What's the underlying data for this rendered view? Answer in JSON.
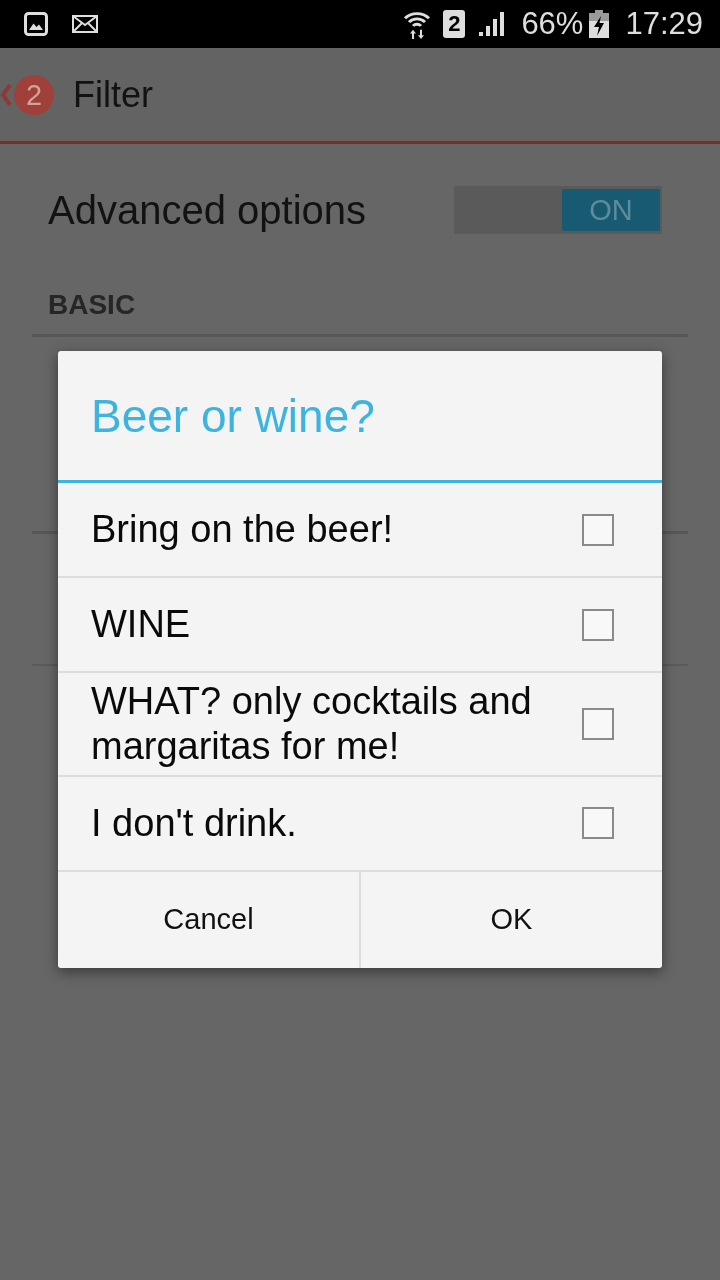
{
  "status_bar": {
    "sim_slot": "2",
    "battery": "66%",
    "time": "17:29"
  },
  "app_bar": {
    "badge": "2",
    "title": "Filter"
  },
  "settings": {
    "advanced": {
      "label": "Advanced options",
      "toggle": {
        "label": "ON",
        "on": true
      }
    },
    "sections": [
      {
        "header": "BASIC"
      }
    ]
  },
  "dialog": {
    "title": "Beer or wine?",
    "options": [
      {
        "label": "Bring on the beer!",
        "checked": false
      },
      {
        "label": "WINE",
        "checked": false
      },
      {
        "label": "WHAT? only cocktails and margaritas for me!",
        "checked": false
      },
      {
        "label": "I don't drink.",
        "checked": false
      }
    ],
    "buttons": [
      "Cancel",
      "OK"
    ]
  }
}
